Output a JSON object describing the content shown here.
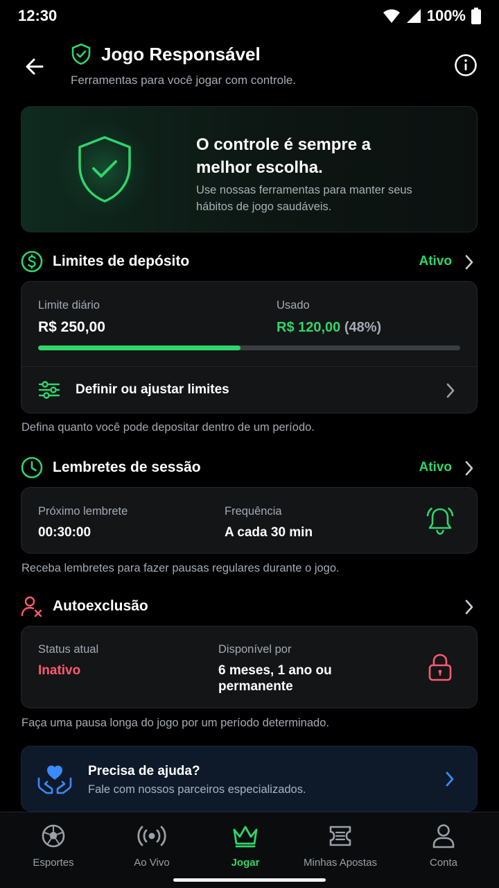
{
  "status_bar": {
    "time": "12:30",
    "battery": "100%"
  },
  "header": {
    "title": "Jogo Responsável",
    "subtitle": "Ferramentas para você jogar com controle."
  },
  "hero": {
    "title": "O controle é sempre a melhor escolha.",
    "description": "Use nossas ferramentas para manter seus hábitos de jogo saudáveis."
  },
  "deposit_limits": {
    "title": "Limites de depósito",
    "status": "Ativo",
    "daily_label": "Limite diário",
    "daily_value": "R$ 250,00",
    "used_label": "Usado",
    "used_value": "R$ 120,00",
    "used_percent_text": "(48%)",
    "used_fraction": 0.48,
    "adjust_label": "Definir ou ajustar limites",
    "caption": "Defina quanto você pode depositar dentro de um período."
  },
  "session_reminders": {
    "title": "Lembretes de sessão",
    "status": "Ativo",
    "next_label": "Próximo lembrete",
    "next_value": "00:30:00",
    "freq_label": "Frequência",
    "freq_value": "A cada 30 min",
    "caption": "Receba lembretes para fazer pausas regulares durante o jogo."
  },
  "self_exclusion": {
    "title": "Autoexclusão",
    "status_label": "Status atual",
    "status_value": "Inativo",
    "available_label": "Disponível por",
    "available_value_line1": "6 meses, 1 ano ou",
    "available_value_line2": "permanente",
    "caption": "Faça uma pausa longa do jogo por um período determinado."
  },
  "help": {
    "title": "Precisa de ajuda?",
    "subtitle": "Fale com nossos parceiros especializados."
  },
  "bottom_nav": [
    {
      "label": "Esportes",
      "icon": "soccer-ball-icon",
      "active": false
    },
    {
      "label": "Ao Vivo",
      "icon": "live-broadcast-icon",
      "active": false
    },
    {
      "label": "Jogar",
      "icon": "crown-icon",
      "active": true
    },
    {
      "label": "Minhas Apostas",
      "icon": "ticket-icon",
      "active": false
    },
    {
      "label": "Conta",
      "icon": "user-icon",
      "active": false
    }
  ],
  "colors": {
    "accent_green": "#2fd56b",
    "danger_red": "#ff5a6e",
    "help_blue": "#3a8bff",
    "background": "#000000"
  }
}
